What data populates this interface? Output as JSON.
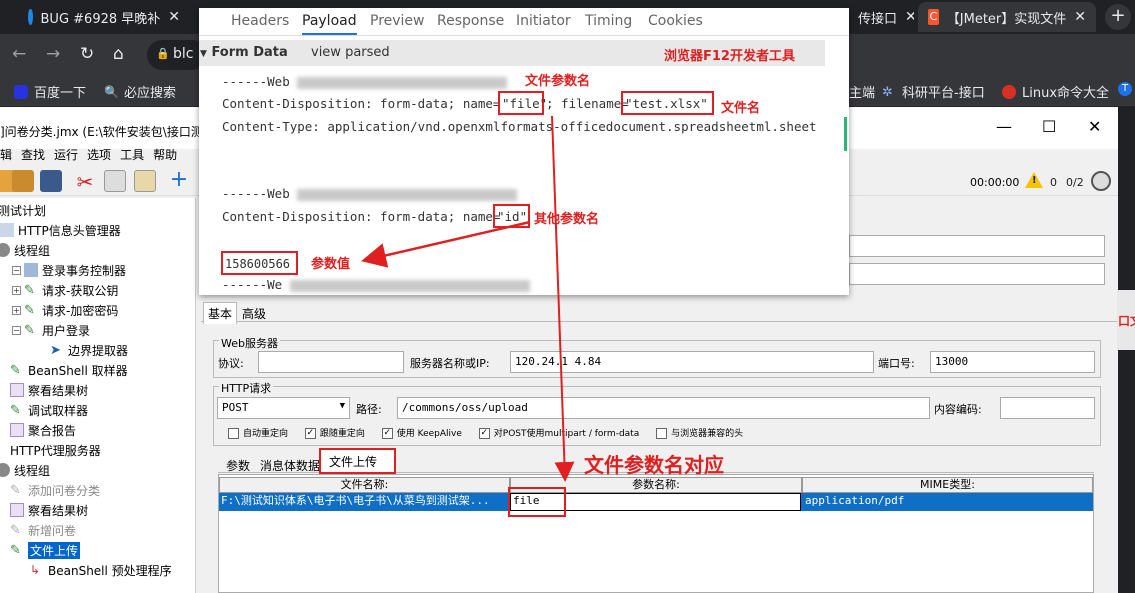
{
  "browser": {
    "tabs": [
      {
        "title": "BUG #6928 早晚补",
        "active": false
      },
      {
        "title": "6928",
        "active": false
      },
      {
        "title": "传接口",
        "active": false
      },
      {
        "title": "【JMeter】实现文件",
        "active": true
      }
    ],
    "omnibox_text": "blc",
    "bookmarks": [
      "百度一下",
      "必应搜索",
      "主端",
      "科研平台-接口",
      "Linux命令大全",
      "T"
    ]
  },
  "jmeter": {
    "window_title": "]问卷分类.jmx (E:\\软件安装包\\接口测",
    "menu": [
      "辑",
      "查找",
      "运行",
      "选项",
      "工具",
      "帮助"
    ],
    "timer": "00:00:00",
    "warn_count": "0",
    "ratio": "0/2",
    "tree": [
      {
        "label": "测试计划",
        "indent": 0,
        "icon": "plan",
        "state": "normal"
      },
      {
        "label": "HTTP信息头管理器",
        "indent": 1,
        "icon": "header",
        "state": "normal"
      },
      {
        "label": "线程组",
        "indent": 0,
        "icon": "gear",
        "state": "normal"
      },
      {
        "label": "登录事务控制器",
        "indent": 1,
        "icon": "controller",
        "state": "normal"
      },
      {
        "label": "请求-获取公钥",
        "indent": 2,
        "icon": "sampler",
        "state": "normal"
      },
      {
        "label": "请求-加密密码",
        "indent": 2,
        "icon": "sampler",
        "state": "normal"
      },
      {
        "label": "用户登录",
        "indent": 2,
        "icon": "sampler",
        "state": "normal"
      },
      {
        "label": "边界提取器",
        "indent": 3,
        "icon": "extractor",
        "state": "normal"
      },
      {
        "label": "BeanShell 取样器",
        "indent": 0,
        "icon": "sampler",
        "state": "normal"
      },
      {
        "label": "察看结果树",
        "indent": 0,
        "icon": "listener",
        "state": "normal"
      },
      {
        "label": "调试取样器",
        "indent": 0,
        "icon": "sampler",
        "state": "normal"
      },
      {
        "label": "聚合报告",
        "indent": 0,
        "icon": "listener",
        "state": "normal"
      },
      {
        "label": "HTTP代理服务器",
        "indent": 0,
        "icon": "proxy",
        "state": "normal"
      },
      {
        "label": "线程组",
        "indent": 0,
        "icon": "gear",
        "state": "normal"
      },
      {
        "label": "添加问卷分类",
        "indent": 0,
        "icon": "sampler",
        "state": "disabled"
      },
      {
        "label": "察看结果树",
        "indent": 0,
        "icon": "listener",
        "state": "normal"
      },
      {
        "label": "新增问卷",
        "indent": 0,
        "icon": "sampler",
        "state": "disabled"
      },
      {
        "label": "文件上传",
        "indent": 0,
        "icon": "sampler",
        "state": "selected"
      },
      {
        "label": "BeanShell 预处理程序",
        "indent": 1,
        "icon": "preproc",
        "state": "normal"
      }
    ],
    "tabs_top": [
      "基本",
      "高级"
    ],
    "web_server_title": "Web服务器",
    "protocol_label": "协议:",
    "protocol_value": "",
    "server_label": "服务器名称或IP:",
    "server_value": "120.24.1 4.84",
    "port_label": "端口号:",
    "port_value": "13000",
    "http_request_title": "HTTP请求",
    "method": "POST",
    "path_label": "路径:",
    "path_value": "/commons/oss/upload",
    "encoding_label": "内容编码:",
    "encoding_value": "",
    "checkboxes": [
      {
        "label": "自动重定向",
        "checked": false
      },
      {
        "label": "跟随重定向",
        "checked": true
      },
      {
        "label": "使用 KeepAlive",
        "checked": true
      },
      {
        "label": "对POST使用multipart / form-data",
        "checked": true
      },
      {
        "label": "与浏览器兼容的头",
        "checked": false
      }
    ],
    "sub_tabs": [
      "参数",
      "消息体数据",
      "文件上传"
    ],
    "file_table": {
      "headers": [
        "文件名称:",
        "参数名称:",
        "MIME类型:"
      ],
      "row": {
        "file": "F:\\测试知识体系\\电子书\\电子书\\从菜鸟到测试架...",
        "param": "file",
        "mime": "application/pdf"
      }
    },
    "right_edge_text": "口文"
  },
  "devtools": {
    "tabs": [
      "Headers",
      "Payload",
      "Preview",
      "Response",
      "Initiator",
      "Timing",
      "Cookies"
    ],
    "active_tab": "Payload",
    "section_title": "Form Data",
    "view_parsed": "view parsed",
    "lines": {
      "boundary1_prefix": "------Web",
      "cd1_prefix": "Content-Disposition: form-data; name=",
      "cd1_name": "\"file\"",
      "cd1_mid": "; filename=",
      "cd1_filename": "\"test.xlsx\"",
      "content_type": "Content-Type: application/vnd.openxmlformats-officedocument.spreadsheetml.sheet",
      "boundary2_prefix": "------Web",
      "cd2_prefix": "Content-Disposition: form-data; name=",
      "cd2_name": "\"id\"",
      "value": "158600566",
      "boundary3_prefix": "------We"
    }
  },
  "annotations": {
    "devtools_title": "浏览器F12开发者工具",
    "file_param_name": "文件参数名",
    "file_name": "文件名",
    "other_param_name": "其他参数名",
    "param_value": "参数值",
    "file_param_match": "文件参数名对应"
  },
  "colors": {
    "annotation_red": "#e02020",
    "selection_blue": "#0f6fc6",
    "tab_active": "#35363a"
  }
}
